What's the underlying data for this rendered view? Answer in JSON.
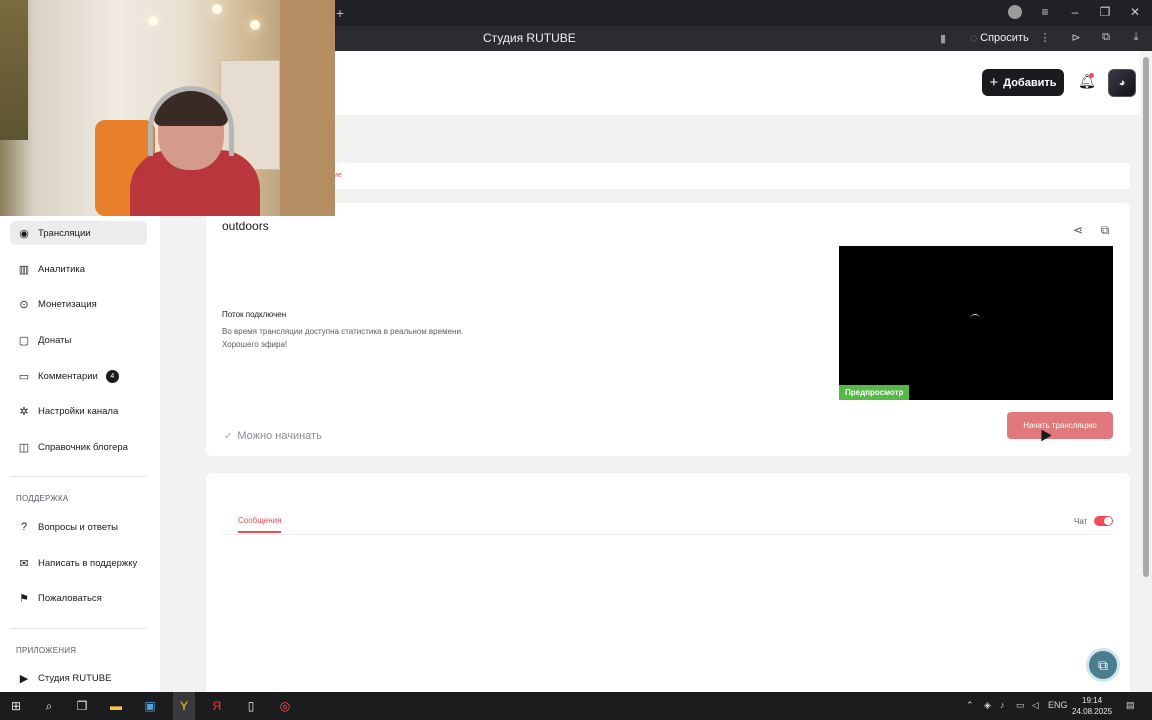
{
  "browser": {
    "page_title": "Студия RUTUBE",
    "ask_label": "Спросить",
    "new_tab": "+",
    "window_controls": [
      "≡",
      "–",
      "❐",
      "✕"
    ]
  },
  "header": {
    "add_button_label": "Добавить"
  },
  "sidebar": {
    "items": [
      {
        "label": "Трансляции",
        "icon": "broadcast-icon",
        "glyph": "◉"
      },
      {
        "label": "Аналитика",
        "icon": "chart-icon",
        "glyph": "▥"
      },
      {
        "label": "Монетизация",
        "icon": "money-icon",
        "glyph": "⊙"
      },
      {
        "label": "Донаты",
        "icon": "gift-icon",
        "glyph": "▢"
      },
      {
        "label": "Комментарии",
        "icon": "comment-icon",
        "glyph": "▭",
        "badge": "4"
      },
      {
        "label": "Настройки канала",
        "icon": "gear-icon",
        "glyph": "✲"
      },
      {
        "label": "Справочник блогера",
        "icon": "book-icon",
        "glyph": "◫"
      }
    ],
    "support_title": "ПОДДЕРЖКА",
    "support_items": [
      {
        "label": "Вопросы и ответы",
        "icon": "question-icon",
        "glyph": "?"
      },
      {
        "label": "Написать в поддержку",
        "icon": "mail-icon",
        "glyph": "✉"
      },
      {
        "label": "Пожаловаться",
        "icon": "flag-icon",
        "glyph": "⚑"
      }
    ],
    "apps_title": "ПРИЛОЖЕНИЯ",
    "apps_items": [
      {
        "label": "Студия RUTUBE",
        "icon": "studio-icon",
        "glyph": "▶"
      }
    ]
  },
  "breadcrumb": {
    "fragment": "ие"
  },
  "stream": {
    "title": "outdoors",
    "status_title": "Поток подключен",
    "status_line1": "Во время трансляции доступна статистика в реальном времени.",
    "status_line2": "Хорошего эфира!",
    "preview_badge": "Предпросмотр",
    "ready_label": "Можно начинать",
    "start_button_label": "Начать трансляцию"
  },
  "chat": {
    "tab_label": "Сообщения",
    "toggle_label": "Чат",
    "toggle_on": true
  },
  "taskbar": {
    "lang": "ENG",
    "time": "19:14",
    "date": "24.08.2025"
  },
  "colors": {
    "accent": "#ef4d56",
    "dark": "#1b1b1f",
    "preview_badge": "#56b847"
  }
}
